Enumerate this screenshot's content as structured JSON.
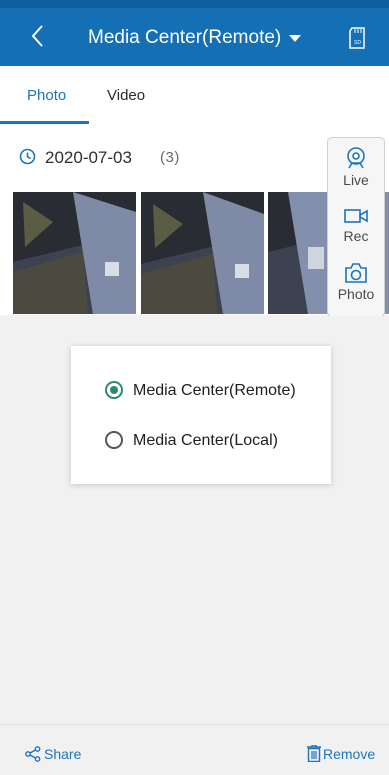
{
  "header": {
    "title": "Media Center(Remote)",
    "back_icon": "chevron-left-icon",
    "dropdown_icon": "caret-down-icon",
    "sd_icon": "sd-card-icon",
    "sd_label": "SD",
    "bg_color": "#156fb4"
  },
  "tabs": [
    {
      "label": "Photo",
      "active": true
    },
    {
      "label": "Video",
      "active": false
    }
  ],
  "gallery": {
    "date": "2020-07-03",
    "count": "(3)",
    "clock_icon": "clock-icon",
    "photos": [
      {
        "name": "photo-1"
      },
      {
        "name": "photo-2"
      },
      {
        "name": "photo-3"
      }
    ]
  },
  "float_panel": {
    "items": [
      {
        "label": "Live",
        "icon": "camera-lens-icon"
      },
      {
        "label": "Rec",
        "icon": "video-camera-icon"
      },
      {
        "label": "Photo",
        "icon": "camera-icon"
      }
    ]
  },
  "dialog": {
    "options": [
      {
        "label": "Media Center(Remote)",
        "selected": true
      },
      {
        "label": "Media Center(Local)",
        "selected": false
      }
    ],
    "accent_color": "#2b8a6e"
  },
  "bottom_bar": {
    "share_label": "Share",
    "share_icon": "share-icon",
    "remove_label": "Remove",
    "remove_icon": "trash-icon",
    "accent_color": "#1c75bc"
  }
}
